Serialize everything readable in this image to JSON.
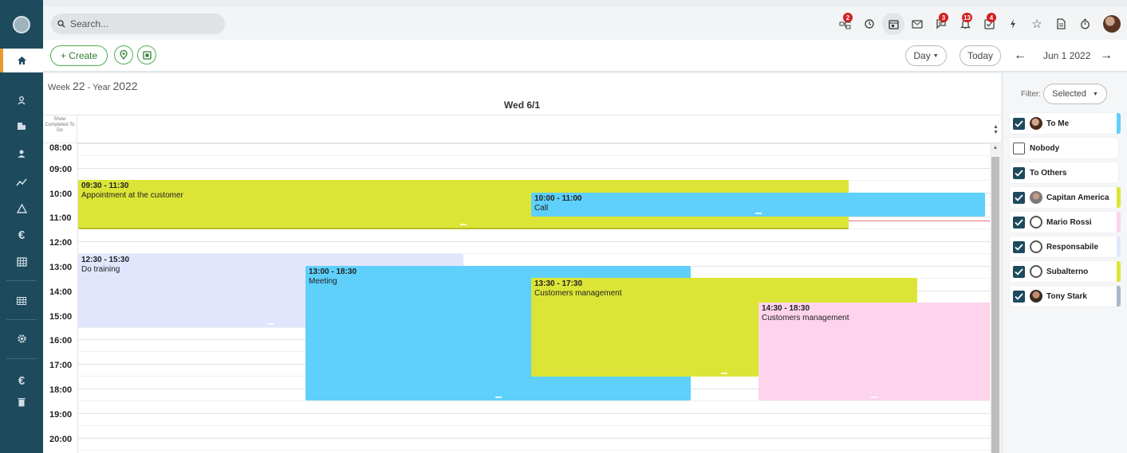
{
  "search": {
    "placeholder": "Search..."
  },
  "toolbar": {
    "create_label": "+ Create",
    "view_label": "Day",
    "today_label": "Today",
    "date_label": "Jun 1 2022"
  },
  "notifications": {
    "workflow_count": "2",
    "chat_count": "3",
    "alerts_count": "13",
    "tasks_count": "4"
  },
  "calendar": {
    "week_prefix": "Week",
    "week_number": "22",
    "year_prefix": "- Year",
    "year": "2022",
    "day_header": "Wed 6/1",
    "allday_label": "Show Completed To Do",
    "hours": [
      "08:00",
      "09:00",
      "10:00",
      "11:00",
      "12:00",
      "13:00",
      "14:00",
      "15:00",
      "16:00",
      "17:00",
      "18:00",
      "19:00",
      "20:00"
    ],
    "events": [
      {
        "time": "09:30 - 11:30",
        "title": "Appointment at the customer",
        "color": "#dce536"
      },
      {
        "time": "10:00 - 11:00",
        "title": "Call",
        "color": "#5ed0fb"
      },
      {
        "time": "12:30 - 15:30",
        "title": "Do training",
        "color": "#e1e6fc"
      },
      {
        "time": "13:00 - 18:30",
        "title": "Meeting",
        "color": "#5ed0fb"
      },
      {
        "time": "13:30 - 17:30",
        "title": "Customers management",
        "color": "#dce536"
      },
      {
        "time": "14:30 - 18:30",
        "title": "Customers management",
        "color": "#fdd4ec"
      }
    ]
  },
  "filter": {
    "label": "Filter:",
    "selected": "Selected",
    "items": [
      {
        "label": "To Me",
        "checked": true,
        "color": "#5ed0fb"
      },
      {
        "label": "Nobody",
        "checked": false,
        "color": ""
      },
      {
        "label": "To Others",
        "checked": true,
        "color": ""
      },
      {
        "label": "Capitan America",
        "checked": true,
        "color": "#dce536"
      },
      {
        "label": "Mario Rossi",
        "checked": true,
        "color": "#fdd4ec"
      },
      {
        "label": "Responsabile",
        "checked": true,
        "color": "#e1e6fc"
      },
      {
        "label": "Subalterno",
        "checked": true,
        "color": "#dce536"
      },
      {
        "label": "Tony Stark",
        "checked": true,
        "color": "#a9b8c9"
      }
    ]
  }
}
